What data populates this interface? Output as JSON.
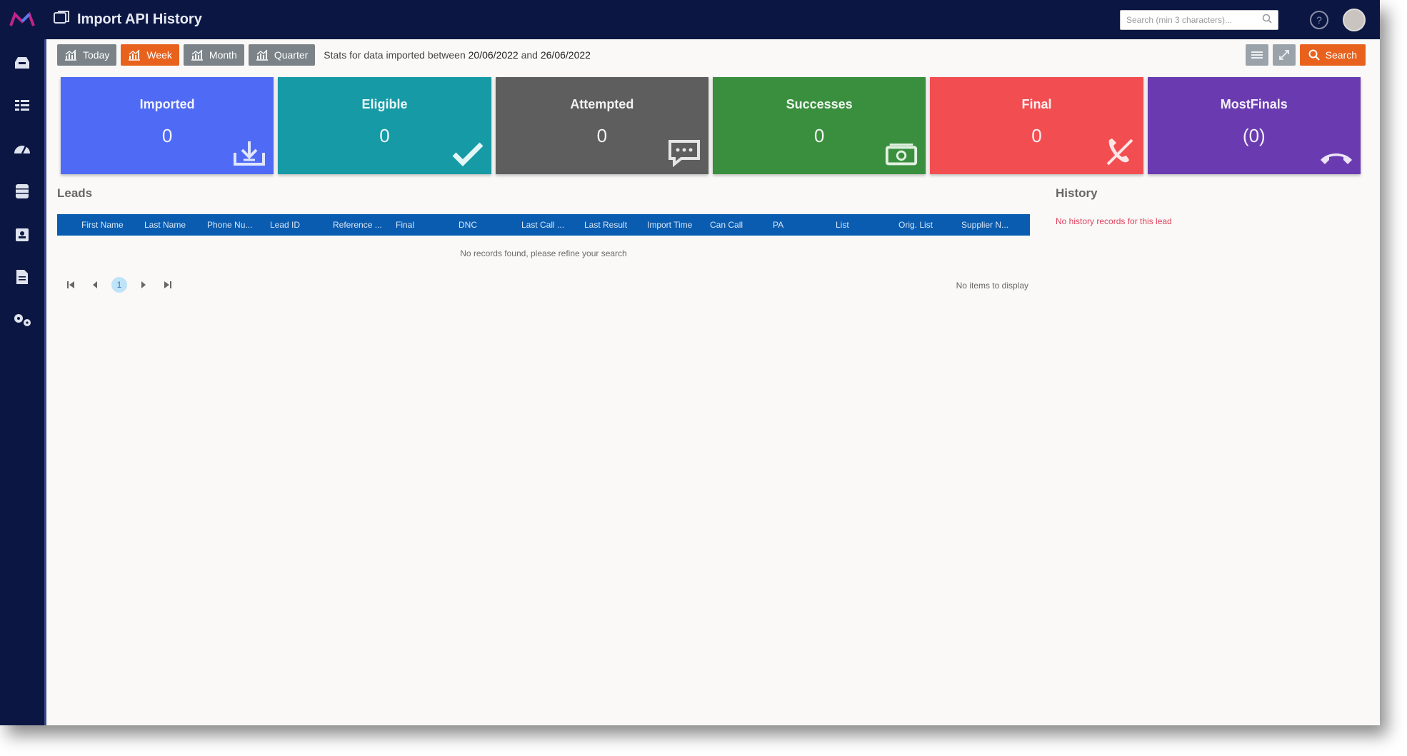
{
  "app": {
    "title": "Import API History",
    "search_placeholder": "Search (min 3 characters)...",
    "brand_color": "#0b1742",
    "accent_color": "#e8621d"
  },
  "toolbar": {
    "periods": [
      {
        "label": "Today",
        "icon": "chart-icon",
        "active": false
      },
      {
        "label": "Week",
        "icon": "chart-icon",
        "active": true
      },
      {
        "label": "Month",
        "icon": "chart-icon",
        "active": false
      },
      {
        "label": "Quarter",
        "icon": "chart-icon",
        "active": false
      }
    ],
    "stats_prefix": "Stats for data imported between",
    "date_from": "20/06/2022",
    "stats_and": "and",
    "date_to": "26/06/2022",
    "search_label": "Search"
  },
  "sidebar": {
    "items": [
      {
        "name": "inbox-icon"
      },
      {
        "name": "list-icon"
      },
      {
        "name": "dashboard-icon"
      },
      {
        "name": "database-icon"
      },
      {
        "name": "contacts-icon"
      },
      {
        "name": "document-icon"
      },
      {
        "name": "settings-icon"
      }
    ]
  },
  "tiles": [
    {
      "label": "Imported",
      "value": "0",
      "color": "#4f6af5",
      "icon": "import-icon"
    },
    {
      "label": "Eligible",
      "value": "0",
      "color": "#169aa5",
      "icon": "check-icon"
    },
    {
      "label": "Attempted",
      "value": "0",
      "color": "#5e5e5e",
      "icon": "chat-icon"
    },
    {
      "label": "Successes",
      "value": "0",
      "color": "#3a8f3e",
      "icon": "money-icon"
    },
    {
      "label": "Final",
      "value": "0",
      "color": "#f24e52",
      "icon": "phone-off-icon"
    },
    {
      "label": "MostFinals",
      "value": "(0)",
      "color": "#6a3bb0",
      "icon": "hangup-icon"
    }
  ],
  "leads": {
    "title": "Leads",
    "columns": [
      "First Name",
      "Last Name",
      "Phone Nu...",
      "Lead ID",
      "Reference ...",
      "Final",
      "DNC",
      "Last Call ...",
      "Last Result",
      "Import Time",
      "Can Call",
      "PA",
      "List",
      "Orig. List",
      "Supplier N..."
    ],
    "empty_message": "No records found, please refine your search",
    "pager": {
      "current_page": "1",
      "info": "No items to display"
    }
  },
  "history": {
    "title": "History",
    "empty_message": "No history records for this lead"
  }
}
